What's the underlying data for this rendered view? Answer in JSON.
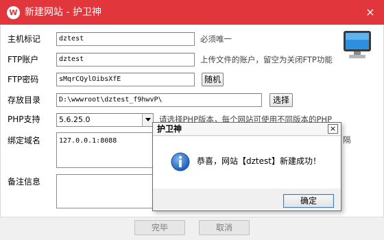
{
  "window": {
    "logo_letter": "W",
    "title": "新建网站 - 护卫神",
    "close_glyph": "×"
  },
  "form": {
    "host": {
      "label": "主机标记",
      "value": "dztest",
      "hint": "必须唯一"
    },
    "ftp_account": {
      "label": "FTP账户",
      "value": "dztest",
      "hint": "上传文件的账户，留空为关闭FTP功能"
    },
    "ftp_password": {
      "label": "FTP密码",
      "value": "sMqrCQylOibsXfE",
      "random_button": "随机"
    },
    "directory": {
      "label": "存放目录",
      "value": "D:\\wwwroot\\dztest_f9hwvP\\",
      "browse_button": "选择"
    },
    "php": {
      "label": "PHP支持",
      "selected": "5.6.25.0",
      "hint": "请选择PHP版本，每个网站可使用不同版本的PHP"
    },
    "domain": {
      "label": "绑定域名",
      "value": "127.0.0.1:8088",
      "hint_tail": "隔"
    },
    "notes": {
      "label": "备注信息",
      "value": ""
    }
  },
  "footer": {
    "finish_button": "完毕",
    "cancel_button": "取消"
  },
  "dialog": {
    "title": "护卫神",
    "close_glyph": "×",
    "message": "恭喜，网站【dztest】新建成功！",
    "ok_button": "确定"
  },
  "colors": {
    "titlebar": "#e0363c",
    "dialog_ok_border": "#3d78c9",
    "info_icon": "#2f6fc6"
  },
  "icons": {
    "app": "app-logo-icon",
    "monitor": "monitor-icon",
    "info": "info-icon",
    "combo": "chevron-down-icon"
  }
}
